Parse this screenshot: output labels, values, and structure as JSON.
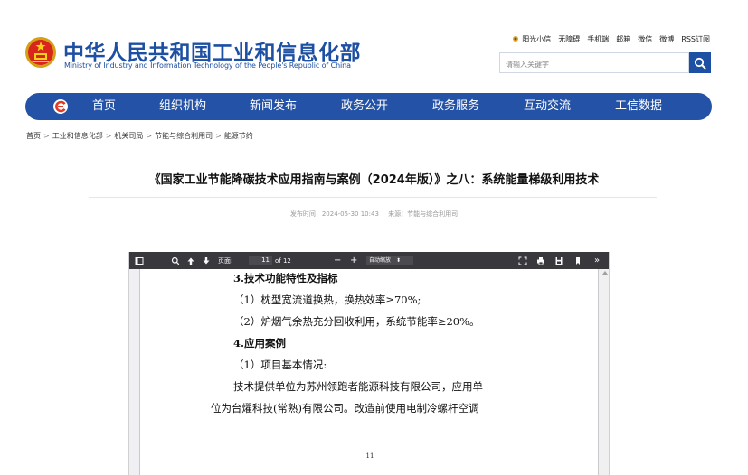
{
  "header": {
    "site_title": "中华人民共和国工业和信息化部",
    "site_subtitle": "Ministry of Industry and Information Technology of the People's Republic of China",
    "top_links": [
      "阳光小信",
      "无障碍",
      "手机端",
      "邮箱",
      "微信",
      "微博",
      "RSS订阅"
    ],
    "search_placeholder": "请输入关键字",
    "brand_color": "#1d4fa3"
  },
  "nav": {
    "items": [
      "首页",
      "组织机构",
      "新闻发布",
      "政务公开",
      "政务服务",
      "互动交流",
      "工信数据"
    ],
    "background": "#2452a6"
  },
  "breadcrumb": {
    "items": [
      "首页",
      "工业和信息化部",
      "机关司局",
      "节能与综合利用司",
      "能源节约"
    ],
    "separator": ">"
  },
  "article": {
    "title": "《国家工业节能降碳技术应用指南与案例（2024年版）》之八：系统能量梯级利用技术",
    "published_label": "发布时间：2024-05-30 10:43",
    "source_label": "来源：节能与综合利用司"
  },
  "pdf_toolbar": {
    "page_label": "页面:",
    "page_current": "11",
    "page_total": "of 12",
    "zoom_label": "自动缩放",
    "zoom_out": "−",
    "zoom_in": "+",
    "more": "»"
  },
  "pdf_page": {
    "lines": [
      "3.技术功能特性及指标",
      "（1）枕型宽流道换热，换热效率≥70%;",
      "（2）炉烟气余热充分回收利用，系统节能率≥20%。",
      "4.应用案例",
      "（1）项目基本情况:",
      "技术提供单位为苏州领跑者能源科技有限公司，应用单",
      "位为台燿科技(常熟)有限公司。改造前使用电制冷螺杆空调"
    ],
    "page_number": "11"
  }
}
